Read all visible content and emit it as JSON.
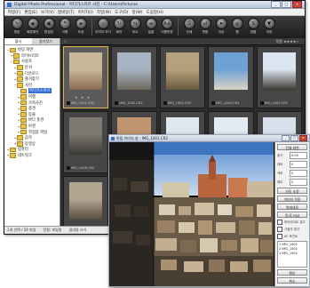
{
  "main_window": {
    "title": "Digital Photo Professional - 마다가스카르 사진 - C:\\Users\\Pictures",
    "window_buttons": [
      "_",
      "□",
      "×"
    ],
    "menu": [
      "파일(F)",
      "편집(E)",
      "보기(V)",
      "썸네일(T)",
      "이미지(I)",
      "작업(W)",
      "도구(O)",
      "창(W)",
      "도움말(H)"
    ],
    "toolbar": [
      {
        "label": "편집",
        "icon": "edit-icon"
      },
      {
        "label": "빠른확인",
        "icon": "quick-check-icon"
      },
      {
        "label": "편집창",
        "icon": "edit-window-icon"
      },
      {
        "label": "크롭",
        "icon": "crop-icon"
      },
      {
        "label": "도장",
        "icon": "stamp-icon"
      },
      {
        "label": "이미지 보기",
        "icon": "view-image-icon"
      },
      {
        "label": "회전",
        "icon": "rotate-icon"
      },
      {
        "label": "비교",
        "icon": "compare-icon"
      },
      {
        "label": "일괄",
        "icon": "batch-icon"
      },
      {
        "label": "이름변경",
        "icon": "rename-icon"
      },
      {
        "label": "인쇄",
        "icon": "print-icon"
      },
      {
        "label": "변환",
        "icon": "convert-icon"
      },
      {
        "label": "전송",
        "icon": "transfer-icon"
      },
      {
        "label": "웹",
        "icon": "web-icon"
      },
      {
        "label": "정렬",
        "icon": "sort-icon"
      },
      {
        "label": "저장",
        "icon": "save-icon"
      }
    ],
    "panel_tabs": [
      "폴더",
      "즐겨찾기"
    ],
    "tree": [
      {
        "label": "바탕 화면",
        "level": 0,
        "expander": "−"
      },
      {
        "label": "라이브러리",
        "level": 1,
        "expander": "+"
      },
      {
        "label": "사용자",
        "level": 1,
        "expander": "−"
      },
      {
        "label": "문서",
        "level": 2,
        "expander": "+"
      },
      {
        "label": "다운로드",
        "level": 2,
        "expander": "+"
      },
      {
        "label": "즐겨찾기",
        "level": 2,
        "expander": "+"
      },
      {
        "label": "사진",
        "level": 2,
        "expander": "−"
      },
      {
        "label": "마다가스카르",
        "level": 3,
        "expander": "",
        "selected": true
      },
      {
        "label": "여행",
        "level": 3,
        "expander": "+"
      },
      {
        "label": "가족사진",
        "level": 3,
        "expander": "+"
      },
      {
        "label": "풍경",
        "level": 3,
        "expander": "+"
      },
      {
        "label": "동물",
        "level": 3,
        "expander": "+"
      },
      {
        "label": "바다 풍경",
        "level": 3,
        "expander": "+"
      },
      {
        "label": "야경",
        "level": 3,
        "expander": "+"
      },
      {
        "label": "작업중 파일",
        "level": 3,
        "expander": "+"
      },
      {
        "label": "음악",
        "level": 2,
        "expander": "+"
      },
      {
        "label": "동영상",
        "level": 2,
        "expander": "+"
      },
      {
        "label": "컴퓨터",
        "level": 0,
        "expander": "+"
      },
      {
        "label": "네트워크",
        "level": 0,
        "expander": "+"
      }
    ],
    "thumb_strip": {
      "left_label": "☾",
      "right_label": "정렬 ★★★★☆"
    },
    "thumbnails": [
      {
        "fname": "IMG_1001.CR2",
        "colors": [
          "#c9b99a",
          "#8a6a52"
        ],
        "stars": "★ ★ ★"
      },
      {
        "fname": "IMG_1002.CR2",
        "colors": [
          "#a7b3c2",
          "#6e6a5c"
        ],
        "stars": ""
      },
      {
        "fname": "IMG_1003.CR2",
        "colors": [
          "#b5a27d",
          "#6a5a3e"
        ],
        "stars": ""
      },
      {
        "fname": "IMG_1004.CR2",
        "colors": [
          "#6ea2d5",
          "#d9d2c4"
        ],
        "stars": ""
      },
      {
        "fname": "IMG_1005.CR2",
        "colors": [
          "#dce6f2",
          "#3e3a32"
        ],
        "stars": ""
      },
      {
        "fname": "IMG_1006.CR2",
        "colors": [
          "#7e7a72",
          "#3a3834"
        ],
        "stars": ""
      },
      {
        "fname": "IMG_1007.CR2",
        "colors": [
          "#bf9470",
          "#6f4b33"
        ],
        "stars": ""
      },
      {
        "fname": "IMG_1008.CR2",
        "colors": [
          "#dfe8f0",
          "#8a8f95"
        ],
        "stars": ""
      },
      {
        "fname": "IMG_1009.CR2",
        "colors": [
          "#e2eaf2",
          "#9aa0a6"
        ],
        "stars": ""
      },
      {
        "fname": "IMG_1010.CR2",
        "colors": [
          "#d7e0ea",
          "#85888a"
        ],
        "stars": ""
      },
      {
        "fname": "IMG_1011.CR2",
        "colors": [
          "#b3a592",
          "#584c3e"
        ],
        "stars": ""
      },
      {
        "fname": "IMG_1012.CR2",
        "colors": [
          "#6c8da8",
          "#3b3b3b"
        ],
        "stars": ""
      }
    ],
    "status": [
      "1개 선택 / 24 파일",
      "정렬: 파일명",
      "썸네일 크기"
    ]
  },
  "viewer_window": {
    "title": "편집 이미지 창 - IMG_1001.CR2",
    "window_buttons": [
      "_",
      "□",
      "×"
    ],
    "side": {
      "top_button": "전체 화면",
      "rows": [
        {
          "label": "밝기",
          "value": "0.00"
        },
        {
          "label": "대비",
          "value": "0"
        },
        {
          "label": "색조",
          "value": "0"
        },
        {
          "label": "채도",
          "value": "0"
        }
      ],
      "buttons": [
        "자동 조정",
        "이미지 적용",
        "원래대로",
        "전/후 비교"
      ],
      "checks": [
        "하이라이트 경고",
        "그림자 경고",
        "AF 포인트"
      ],
      "list_items": [
        "1 IMG_1001",
        "2 IMG_1002",
        "3 IMG_1003"
      ],
      "bottom_buttons": [
        "확인",
        "취소"
      ]
    }
  }
}
